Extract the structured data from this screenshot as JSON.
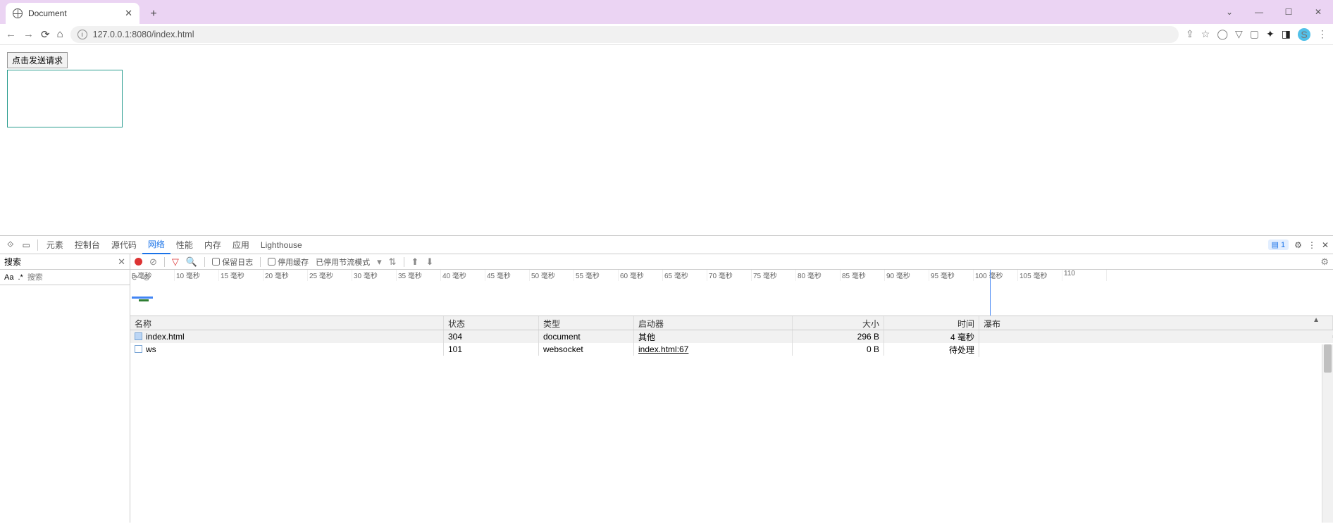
{
  "window": {
    "tab_title": "Document"
  },
  "address": {
    "url": "127.0.0.1:8080/index.html"
  },
  "page": {
    "button_label": "点击发送请求"
  },
  "devtools": {
    "tabs": [
      "元素",
      "控制台",
      "源代码",
      "网络",
      "性能",
      "内存",
      "应用",
      "Lighthouse"
    ],
    "active_tab_index": 3,
    "issues_count": "1",
    "search": {
      "title": "搜索",
      "placeholder": "搜索",
      "aa": "Aa",
      "regex": ".*"
    },
    "network_toolbar": {
      "preserve_log": "保留日志",
      "disable_cache": "停用缓存",
      "throttling": "已停用节流模式"
    },
    "timeline_ticks": [
      "5 毫秒",
      "10 毫秒",
      "15 毫秒",
      "20 毫秒",
      "25 毫秒",
      "30 毫秒",
      "35 毫秒",
      "40 毫秒",
      "45 毫秒",
      "50 毫秒",
      "55 毫秒",
      "60 毫秒",
      "65 毫秒",
      "70 毫秒",
      "75 毫秒",
      "80 毫秒",
      "85 毫秒",
      "90 毫秒",
      "95 毫秒",
      "100 毫秒",
      "105 毫秒",
      "110"
    ],
    "columns": {
      "name": "名称",
      "status": "状态",
      "type": "类型",
      "initiator": "启动器",
      "size": "大小",
      "time": "时间",
      "waterfall": "瀑布"
    },
    "rows": [
      {
        "name": "index.html",
        "status": "304",
        "type": "document",
        "initiator": "其他",
        "size": "296 B",
        "time": "4 毫秒",
        "selected": true,
        "has_wf": true
      },
      {
        "name": "ws",
        "status": "101",
        "type": "websocket",
        "initiator": "index.html:67",
        "initiator_link": true,
        "size": "0 B",
        "time": "待处理",
        "selected": false,
        "empty_icon": true
      }
    ]
  }
}
